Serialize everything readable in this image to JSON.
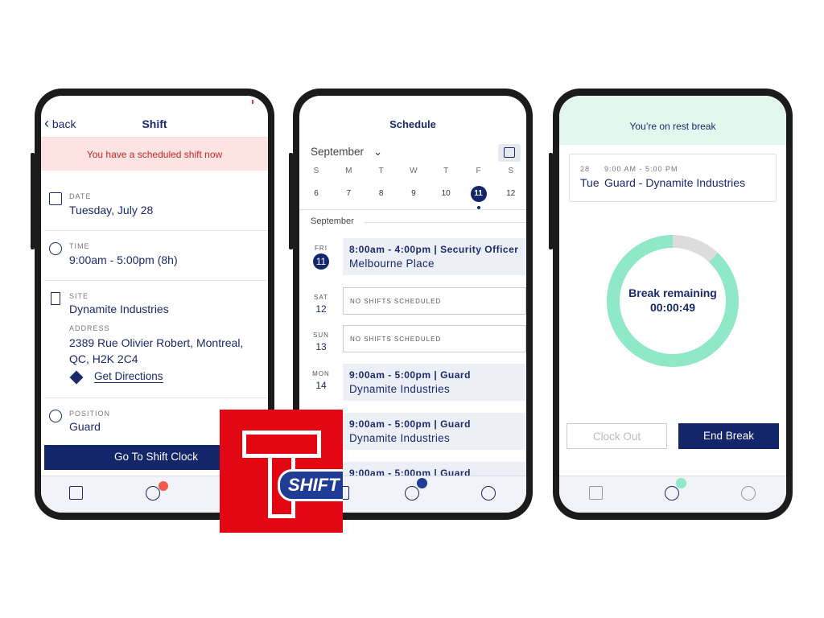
{
  "phone1": {
    "back": "back",
    "title": "Shift",
    "alert": "You have a scheduled shift now",
    "date_label": "DATE",
    "date": "Tuesday, July 28",
    "time_label": "TIME",
    "time": "9:00am - 5:00pm (8h)",
    "site_label": "SITE",
    "site": "Dynamite Industries",
    "address_label": "ADDRESS",
    "address": "2389 Rue Olivier Robert, Montreal, QC, H2K 2C4",
    "directions": "Get Directions",
    "position_label": "POSITION",
    "position": "Guard",
    "button": "Go To Shift Clock",
    "badge_color": "#f05a4a"
  },
  "phone2": {
    "title": "Schedule",
    "month": "September",
    "weekdays": [
      "S",
      "M",
      "T",
      "W",
      "T",
      "F",
      "S"
    ],
    "dates": [
      "6",
      "7",
      "8",
      "9",
      "10",
      "11",
      "12"
    ],
    "selected": "11",
    "section": "September",
    "days": [
      {
        "w": "FRI",
        "n": "11",
        "time": "8:00am - 4:00pm | Security Officer",
        "site": "Melbourne Place"
      },
      {
        "w": "SAT",
        "n": "12",
        "empty": "NO SHIFTS SCHEDULED"
      },
      {
        "w": "SUN",
        "n": "13",
        "empty": "NO SHIFTS SCHEDULED"
      },
      {
        "w": "MON",
        "n": "14",
        "time": "9:00am - 5:00pm | Guard",
        "site": "Dynamite Industries"
      },
      {
        "time": "9:00am - 5:00pm | Guard",
        "site": "Dynamite Industries"
      },
      {
        "time": "9:00am - 5:00pm | Guard"
      }
    ],
    "badge_color": "#1f3c96"
  },
  "phone3": {
    "banner": "You’re on rest break",
    "day_num": "28",
    "hours": "9:00 AM - 5:00 PM",
    "day": "Tue",
    "shift": "Guard - Dynamite Industries",
    "ring_label": "Break remaining",
    "ring_time": "00:00:49",
    "remaining_fraction": 0.88,
    "clock_out": "Clock Out",
    "end_break": "End Break",
    "accent": "#8fe8c8",
    "badge_color": "#8fe8c8"
  },
  "logo": {
    "text": "SHIFT",
    "color": "#e30613"
  }
}
